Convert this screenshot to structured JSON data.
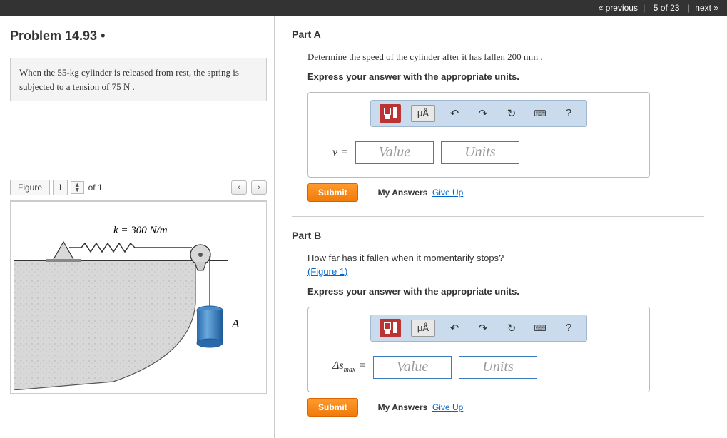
{
  "nav": {
    "prev": "« previous",
    "pos": "5 of 23",
    "next": "next »"
  },
  "problem": {
    "title": "Problem 14.93 •",
    "statement_html": "When the 55-kg cylinder is released from rest, the spring is subjected to a tension of 75 N ."
  },
  "figure": {
    "label": "Figure",
    "num": "1",
    "of": "of 1",
    "k_label": "k = 300 N/m",
    "point": "A"
  },
  "toolbar": {
    "mu": "μÅ",
    "help": "?"
  },
  "partA": {
    "title": "Part A",
    "question": "Determine the speed of the cylinder after it has fallen 200 mm .",
    "instruct": "Express your answer with the appropriate units.",
    "var": "v =",
    "value_ph": "Value",
    "units_ph": "Units",
    "submit": "Submit",
    "myans": "My Answers",
    "giveup": "Give Up"
  },
  "partB": {
    "title": "Part B",
    "q1": "How far has it fallen when it momentarily stops?",
    "figlink": "(Figure 1)",
    "instruct": "Express your answer with the appropriate units.",
    "var_html": "Δs",
    "var_sub": "max",
    "eq": " =",
    "value_ph": "Value",
    "units_ph": "Units",
    "submit": "Submit",
    "myans": "My Answers",
    "giveup": "Give Up"
  }
}
